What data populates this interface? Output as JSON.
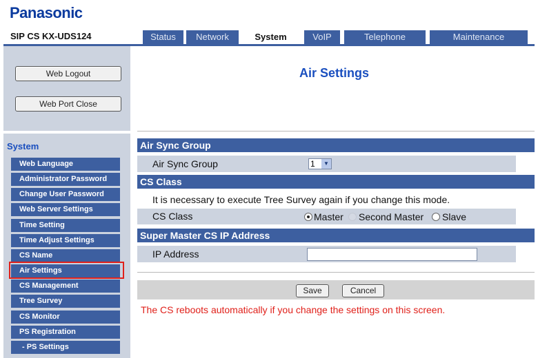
{
  "header": {
    "brand": "Panasonic",
    "model": "SIP CS KX-UDS124",
    "tabs": [
      "Status",
      "Network",
      "System",
      "VoIP",
      "Telephone",
      "Maintenance"
    ],
    "active_tab": "System"
  },
  "sidebar": {
    "buttons": {
      "logout": "Web Logout",
      "port_close": "Web Port Close"
    },
    "section_label": "System",
    "items": [
      "Web Language",
      "Administrator Password",
      "Change User Password",
      "Web Server Settings",
      "Time Setting",
      "Time Adjust Settings",
      "CS Name",
      "Air Settings",
      "CS Management",
      "Tree Survey",
      "CS Monitor",
      "PS Registration",
      "- PS Settings"
    ],
    "selected_item": "Air Settings"
  },
  "main": {
    "title": "Air Settings",
    "air_sync": {
      "header": "Air Sync Group",
      "label": "Air Sync Group",
      "value": "1"
    },
    "cs_class": {
      "header": "CS Class",
      "note": "It is necessary to execute Tree Survey again if you change this mode.",
      "label": "CS Class",
      "options": [
        "Master",
        "Second Master",
        "Slave"
      ],
      "selected": "Master"
    },
    "super_master": {
      "header": "Super Master CS IP Address",
      "label": "IP Address",
      "value": ""
    },
    "save_label": "Save",
    "cancel_label": "Cancel",
    "warning": "The CS reboots automatically if you change the settings on this screen."
  },
  "colors": {
    "nav_blue": "#3d5fa0",
    "title_blue": "#1a4fbf",
    "panel_gray": "#ccd3df",
    "warning_red": "#e0201a"
  }
}
